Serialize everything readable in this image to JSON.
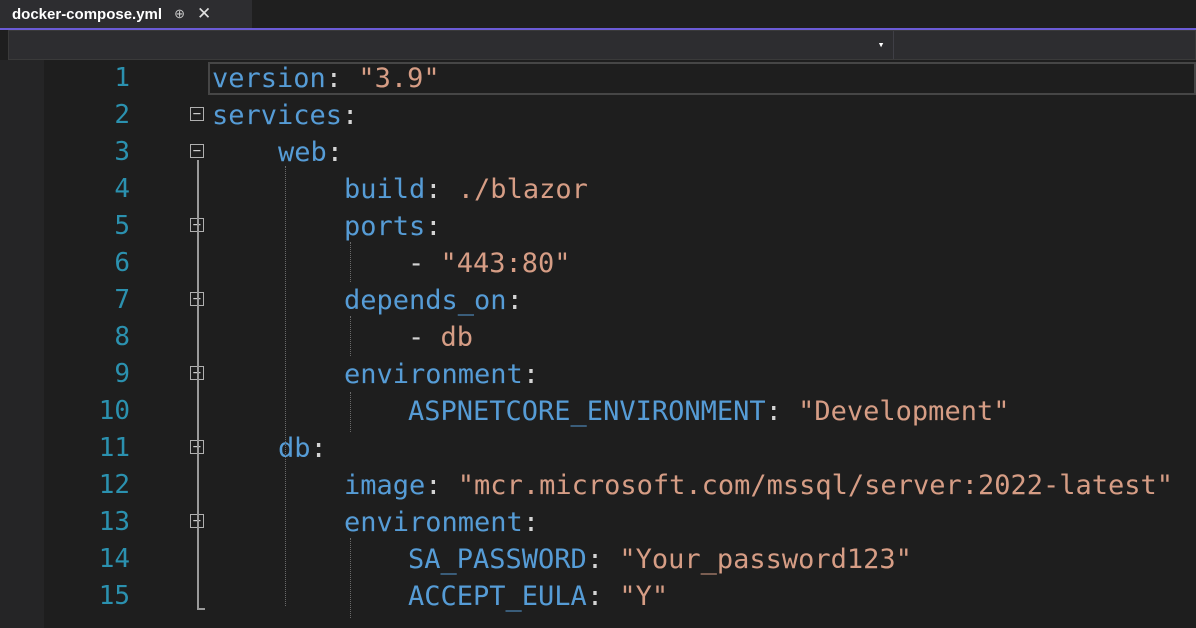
{
  "tab": {
    "filename": "docker-compose.yml",
    "pin_glyph": "⊕",
    "close_glyph": "✕"
  },
  "navbar": {
    "dropdown_glyph": "▾"
  },
  "colors": {
    "keyword": "#569cd6",
    "string": "#d69d85",
    "line_number": "#2b91af",
    "accent": "#6b5bd6",
    "background": "#1e1e1e"
  },
  "lines": [
    {
      "n": "1",
      "key": "version",
      "sep": ": ",
      "val": "\"3.9\"",
      "indent": 0
    },
    {
      "n": "2",
      "key": "services",
      "sep": ":",
      "val": "",
      "indent": 0
    },
    {
      "n": "3",
      "key": "web",
      "sep": ":",
      "val": "",
      "indent": 1
    },
    {
      "n": "4",
      "key": "build",
      "sep": ": ",
      "val": "./blazor",
      "indent": 2
    },
    {
      "n": "5",
      "key": "ports",
      "sep": ":",
      "val": "",
      "indent": 2
    },
    {
      "n": "6",
      "key": "",
      "sep": "- ",
      "val": "\"443:80\"",
      "indent": 3
    },
    {
      "n": "7",
      "key": "depends_on",
      "sep": ":",
      "val": "",
      "indent": 2
    },
    {
      "n": "8",
      "key": "",
      "sep": "- ",
      "val": "db",
      "indent": 3
    },
    {
      "n": "9",
      "key": "environment",
      "sep": ":",
      "val": "",
      "indent": 2
    },
    {
      "n": "10",
      "key": "ASPNETCORE_ENVIRONMENT",
      "sep": ": ",
      "val": "\"Development\"",
      "indent": 3
    },
    {
      "n": "11",
      "key": "db",
      "sep": ":",
      "val": "",
      "indent": 1
    },
    {
      "n": "12",
      "key": "image",
      "sep": ": ",
      "val": "\"mcr.microsoft.com/mssql/server:2022-latest\"",
      "indent": 2
    },
    {
      "n": "13",
      "key": "environment",
      "sep": ":",
      "val": "",
      "indent": 2
    },
    {
      "n": "14",
      "key": "SA_PASSWORD",
      "sep": ": ",
      "val": "\"Your_password123\"",
      "indent": 3
    },
    {
      "n": "15",
      "key": "ACCEPT_EULA",
      "sep": ": ",
      "val": "\"Y\"",
      "indent": 3
    }
  ],
  "fold_lines": [
    "2",
    "3",
    "5",
    "7",
    "9",
    "11",
    "13"
  ]
}
